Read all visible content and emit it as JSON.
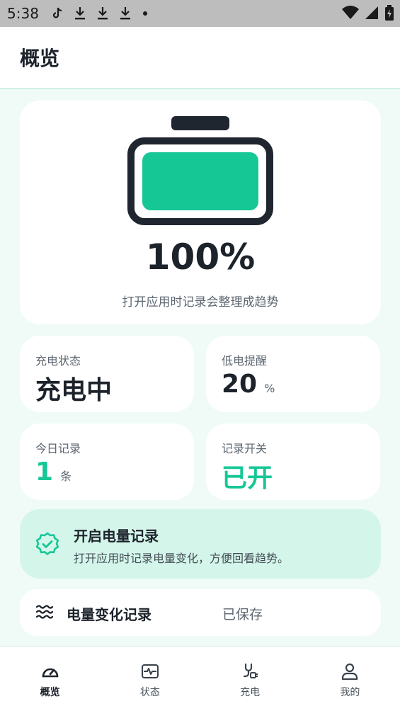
{
  "status_bar": {
    "time": "5:38",
    "notification_icons": [
      "tiktok-icon",
      "download-icon",
      "download-icon",
      "download-icon",
      "dot-icon"
    ],
    "system_icons": [
      "wifi-icon",
      "signal-icon",
      "battery-charging-icon"
    ]
  },
  "app_bar": {
    "title": "概览"
  },
  "battery": {
    "level": 1.0,
    "percent_text": "100%",
    "hint": "打开应用时记录会整理成趋势",
    "fill_color": "#16c796"
  },
  "stats": {
    "charge_status": {
      "label": "充电状态",
      "value": "充电中"
    },
    "low_alert": {
      "label": "低电提醒",
      "value": "20",
      "unit": "%"
    },
    "today_records": {
      "label": "今日记录",
      "value": "1",
      "unit": "条"
    },
    "record_switch": {
      "label": "记录开关",
      "value": "已开"
    }
  },
  "banner": {
    "title": "开启电量记录",
    "desc": "打开应用时记录电量变化，方便回看趋势。",
    "icon": "verified-check-icon"
  },
  "record_row": {
    "icon": "waves-icon",
    "title": "电量变化记录",
    "status": "已保存"
  },
  "nav": {
    "items": [
      {
        "label": "概览",
        "icon": "gauge-icon",
        "active": true
      },
      {
        "label": "状态",
        "icon": "pulse-icon",
        "active": false
      },
      {
        "label": "充电",
        "icon": "plug-icon",
        "active": false
      },
      {
        "label": "我的",
        "icon": "person-icon",
        "active": false
      }
    ]
  },
  "colors": {
    "accent": "#16c796",
    "text": "#1d232b",
    "background": "#f0fbf7",
    "banner": "#d4f6ea"
  }
}
